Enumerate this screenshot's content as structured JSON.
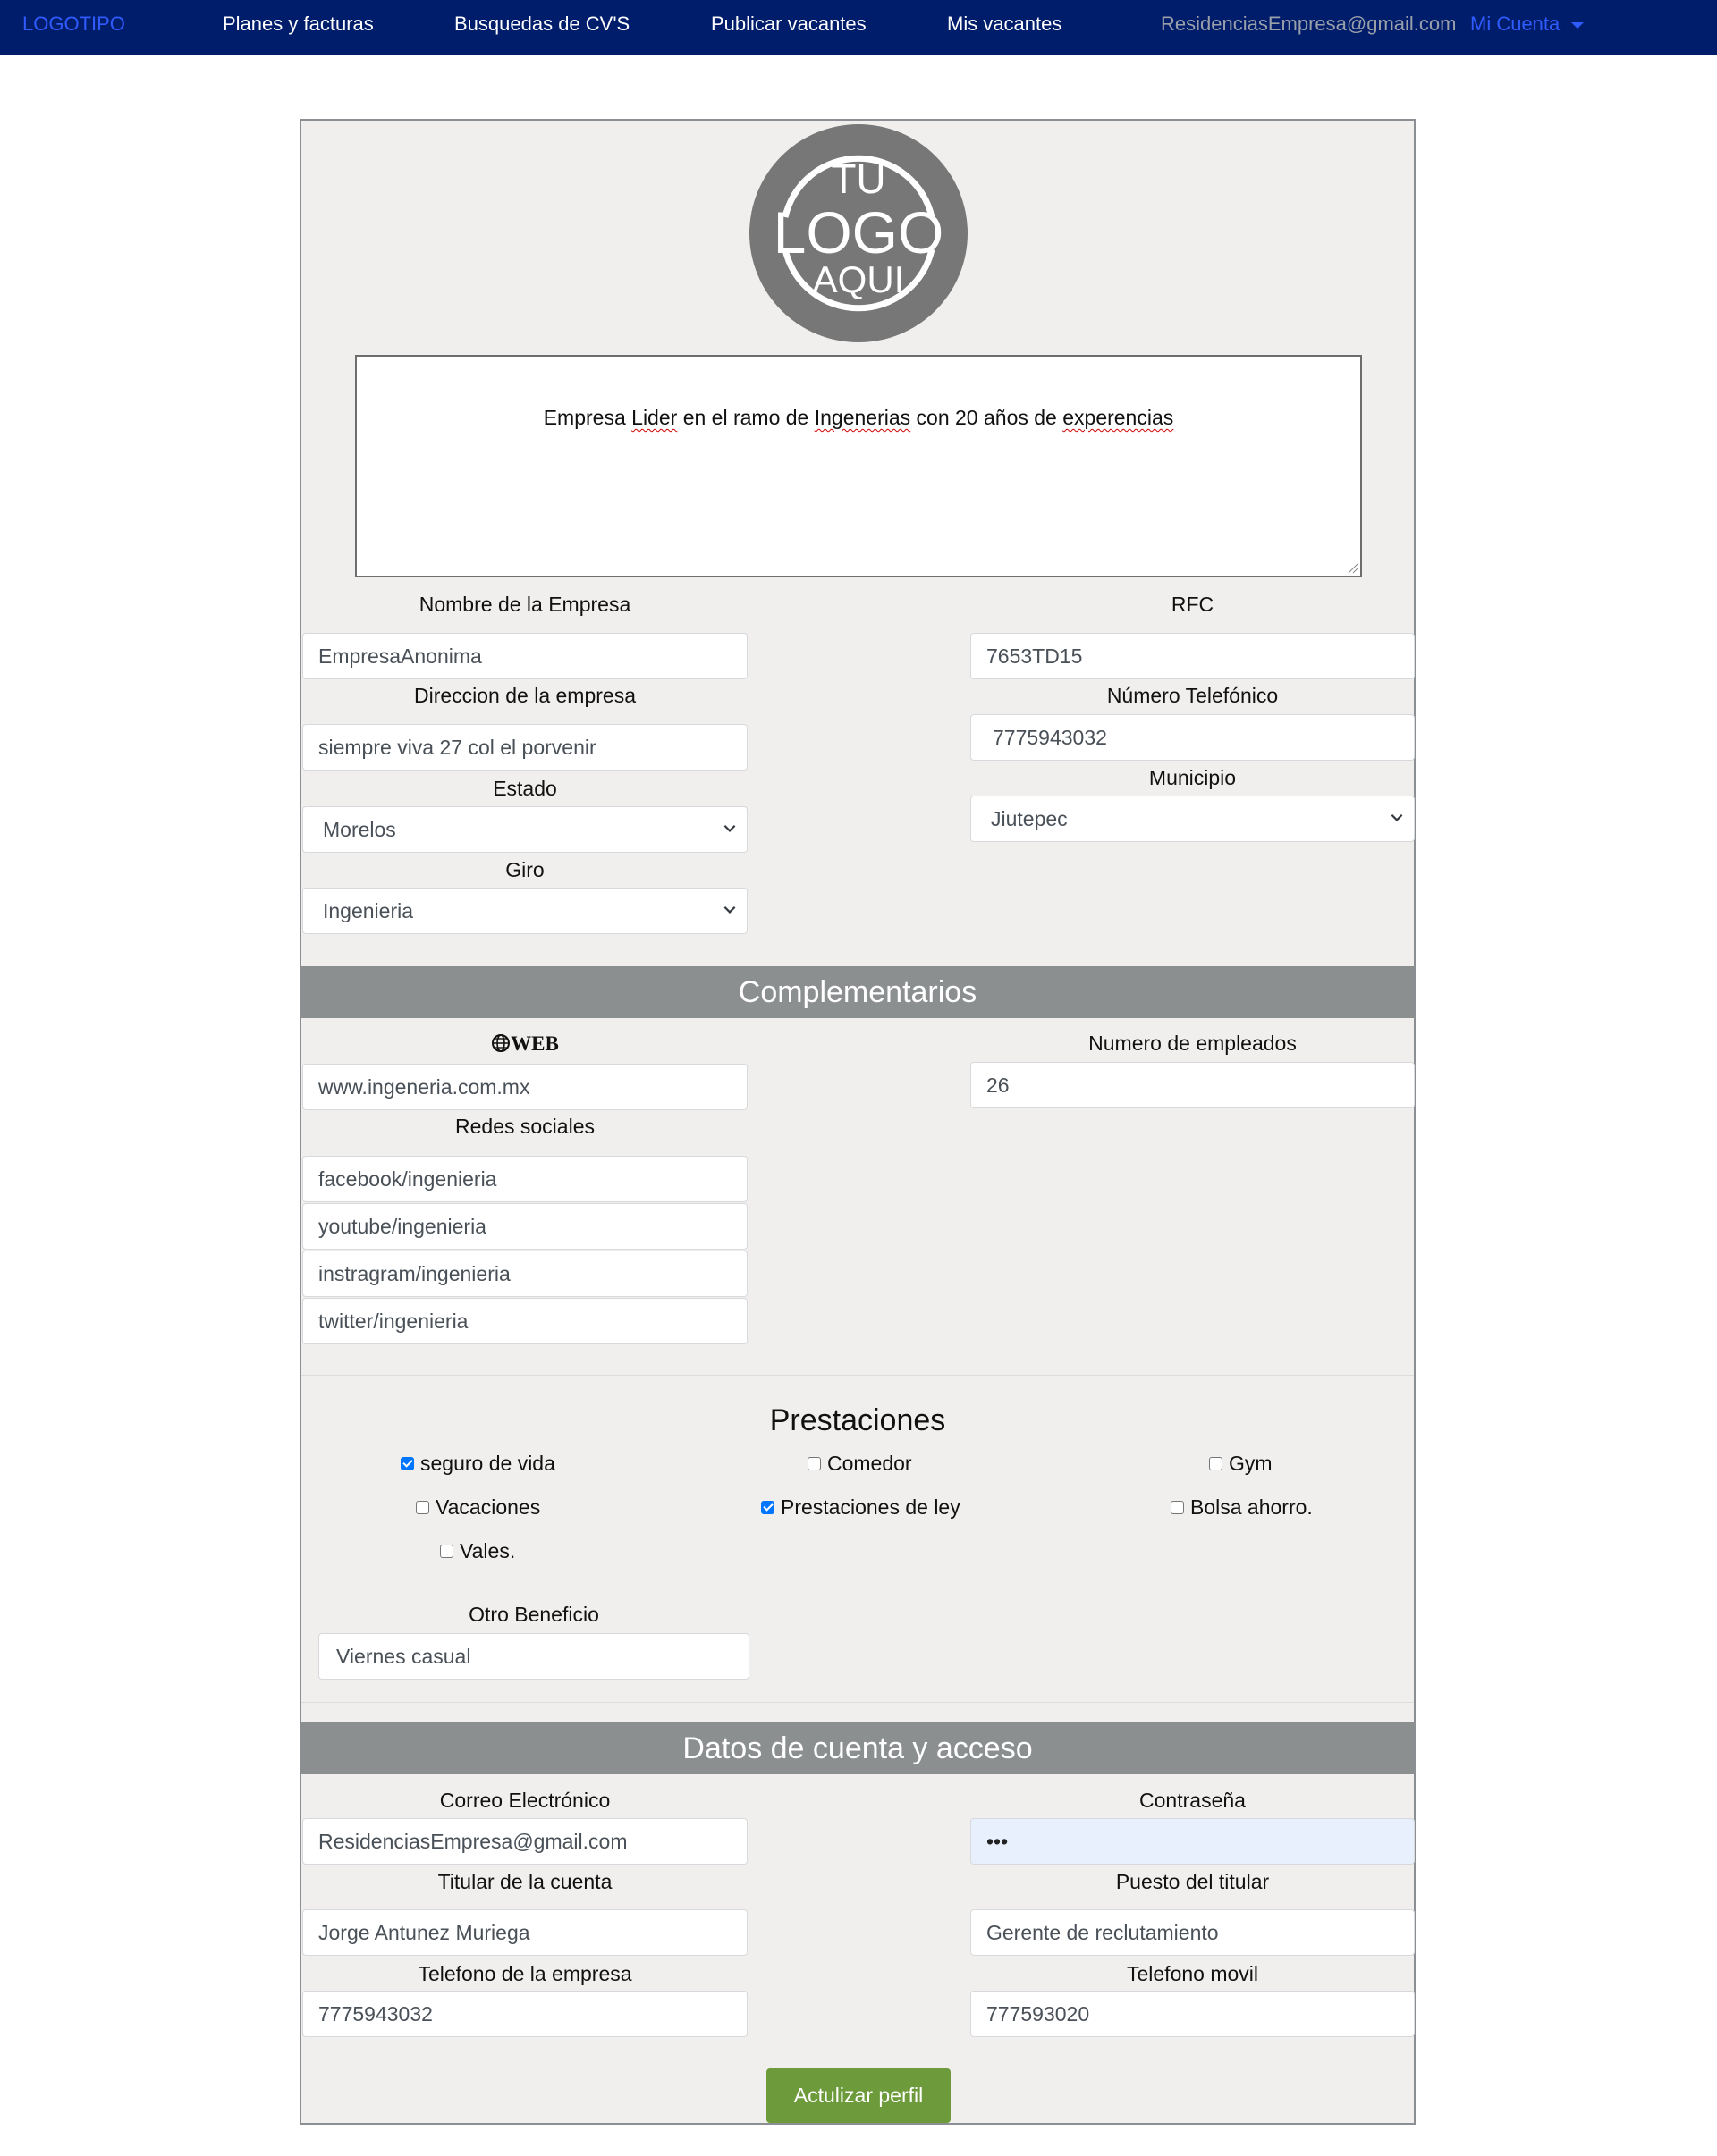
{
  "navbar": {
    "brand": "LOGOTIPO",
    "links": [
      "Planes y facturas",
      "Busquedas de CV'S",
      "Publicar vacantes",
      "Mis vacantes"
    ],
    "email": "ResidenciasEmpresa@gmail.com",
    "account": "Mi Cuenta"
  },
  "logo": {
    "line1": "TU",
    "line2": "LOGO",
    "line3": "AQUI"
  },
  "description": {
    "w1": "Empresa ",
    "w2": "Lider",
    "w3": " en el ramo de ",
    "w4": "Ingenerias",
    "w5": " con 20 años de ",
    "w6": "experencias"
  },
  "company": {
    "name_label": "Nombre de la Empresa",
    "name_value": "EmpresaAnonima",
    "rfc_label": "RFC",
    "rfc_value": "7653TD15",
    "address_label": "Direccion de la empresa",
    "address_value": "siempre viva 27 col el porvenir",
    "phone_label": "Número Telefónico",
    "phone_value": "7775943032",
    "state_label": "Estado",
    "state_value": "Morelos",
    "municipality_label": "Municipio",
    "municipality_value": "Jiutepec",
    "sector_label": "Giro",
    "sector_value": "Ingenieria"
  },
  "complementarios": {
    "title": "Complementarios",
    "web_label": "WEB",
    "web_value": "www.ingeneria.com.mx",
    "employees_label": "Numero de empleados",
    "employees_value": "26",
    "social_label": "Redes sociales",
    "social": [
      "facebook/ingenieria",
      "youtube/ingenieria",
      "instragram/ingenieria",
      "twitter/ingenieria"
    ]
  },
  "prestaciones": {
    "title": "Prestaciones",
    "items": [
      {
        "label": "seguro de vida",
        "checked": true
      },
      {
        "label": "Comedor",
        "checked": false
      },
      {
        "label": "Gym",
        "checked": false
      },
      {
        "label": "Vacaciones",
        "checked": false
      },
      {
        "label": "Prestaciones de ley",
        "checked": true
      },
      {
        "label": "Bolsa ahorro.",
        "checked": false
      },
      {
        "label": "Vales.",
        "checked": false
      }
    ],
    "other_label": "Otro Beneficio",
    "other_value": "Viernes casual"
  },
  "account": {
    "title": "Datos de cuenta y acceso",
    "email_label": "Correo Electrónico",
    "email_value": "ResidenciasEmpresa@gmail.com",
    "password_label": "Contraseña",
    "password_value": "•••",
    "holder_label": "Titular de la cuenta",
    "holder_value": "Jorge Antunez Muriega",
    "position_label": "Puesto del titular",
    "position_value": "Gerente de reclutamiento",
    "company_phone_label": "Telefono de la empresa",
    "company_phone_value": "7775943032",
    "mobile_label": "Telefono movil",
    "mobile_value": "777593020"
  },
  "submit_label": "Actulizar perfil",
  "colors": {
    "navbar": "#001d6b",
    "brand": "#2f5bff",
    "section_bar": "#8c8f90",
    "submit": "#6d9a3a",
    "card": "#f0efed"
  }
}
